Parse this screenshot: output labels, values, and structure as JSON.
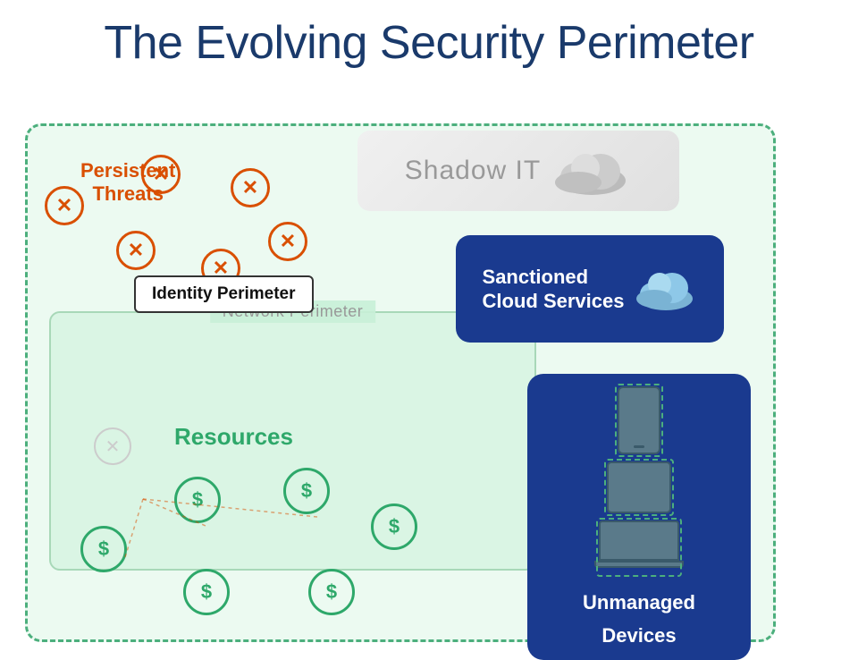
{
  "title": "The Evolving Security Perimeter",
  "labels": {
    "shadow_it": "Shadow IT",
    "identity_perimeter": "Identity Perimeter",
    "network_perimeter": "Network Perimeter",
    "sanctioned_cloud": "Sanctioned\nCloud Services",
    "sanctioned_cloud_line1": "Sanctioned",
    "sanctioned_cloud_line2": "Cloud Services",
    "unmanaged_devices_line1": "Unmanaged",
    "unmanaged_devices_line2": "Devices",
    "persistent_threats_line1": "Persistent",
    "persistent_threats_line2": "Threats",
    "resources": "Resources"
  },
  "colors": {
    "title": "#1a3a6b",
    "threat_red": "#d94f00",
    "green": "#2ea86a",
    "navy": "#1a3a8f",
    "dashed_border": "#4caf7d",
    "gray": "#999"
  }
}
